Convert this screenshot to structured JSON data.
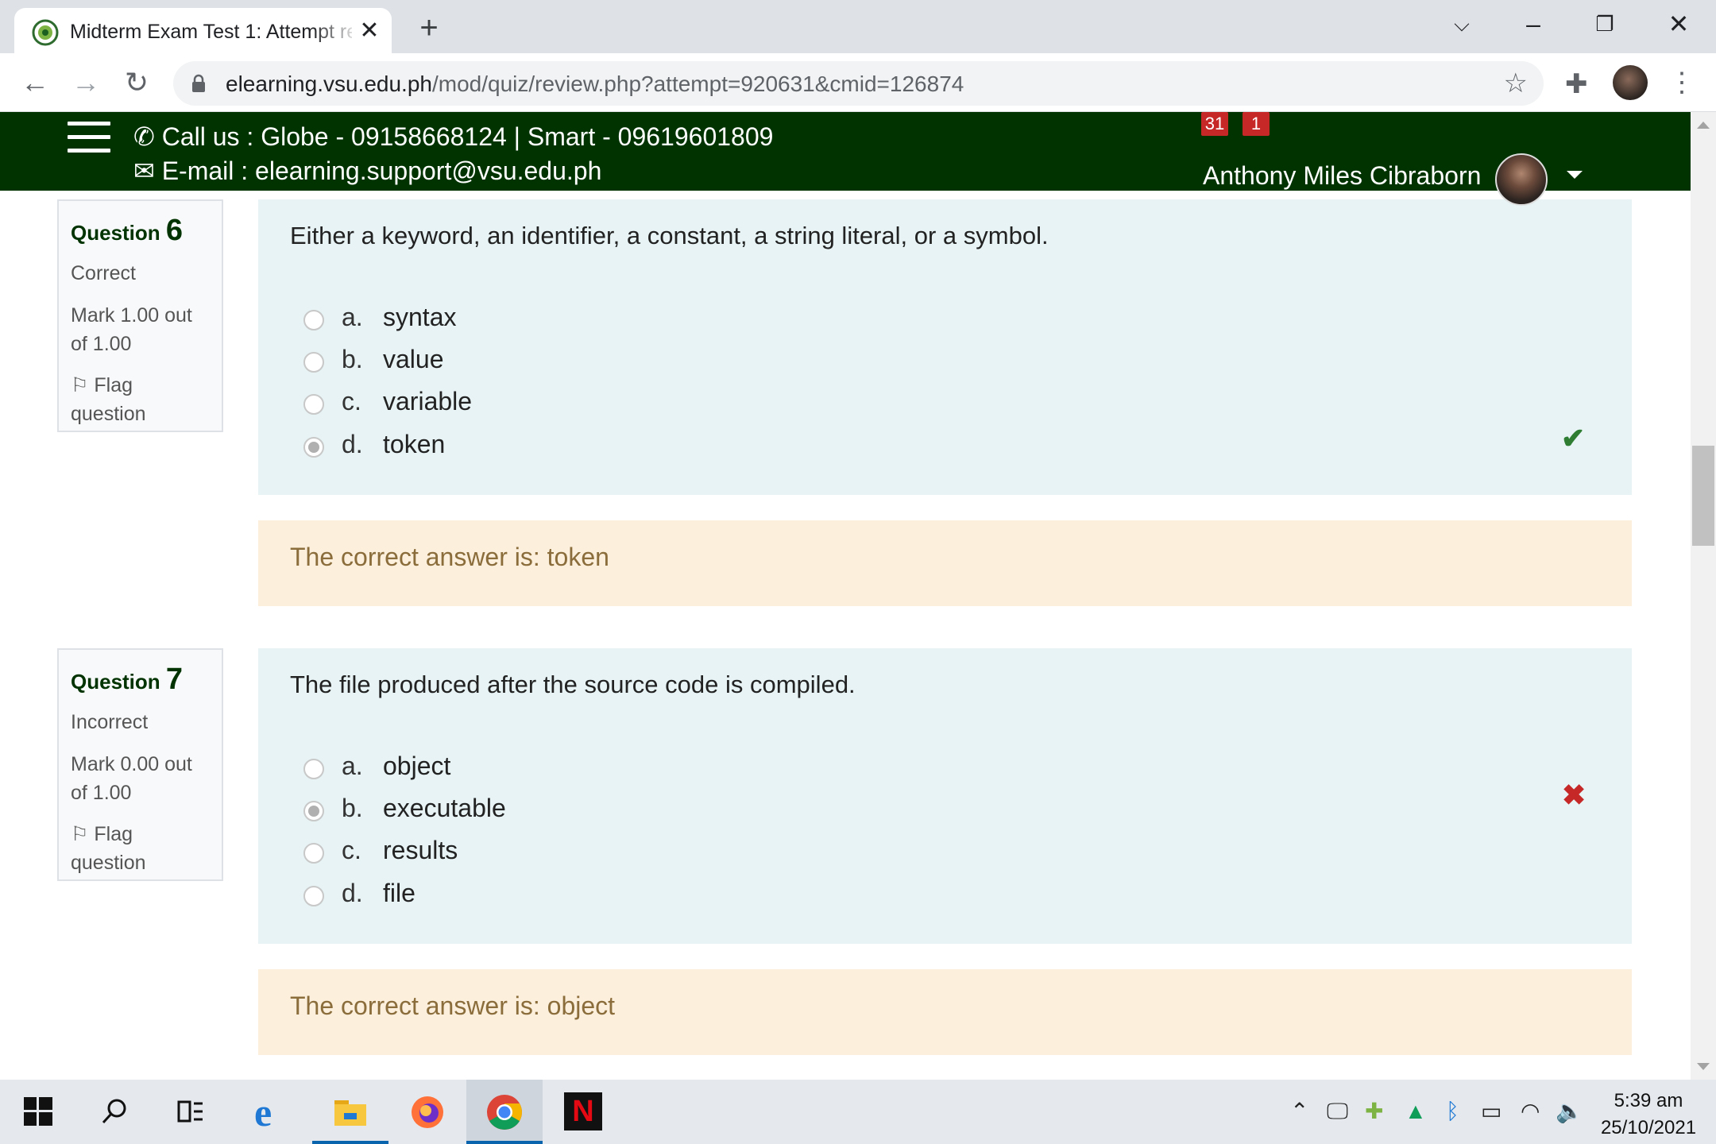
{
  "browser": {
    "tab_title": "Midterm Exam Test 1: Attempt re",
    "new_tab": "+",
    "url_host": "elearning.vsu.edu.ph",
    "url_path": "/mod/quiz/review.php?attempt=920631&cmid=126874"
  },
  "header": {
    "call_us": "Call us : Globe - 09158668124  |  Smart - 09619601809",
    "email": "E-mail : elearning.support@vsu.edu.ph",
    "notification_count": "31",
    "message_count": "1",
    "user_name": "Anthony Miles Cibraborn"
  },
  "questions": [
    {
      "label": "Question",
      "number": "6",
      "state": "Correct",
      "grade": "Mark 1.00 out of 1.00",
      "flag": "Flag question",
      "text": "Either a keyword, an identifier, a constant, a string literal, or a symbol.",
      "options": [
        {
          "letter": "a.",
          "text": "syntax",
          "selected": false
        },
        {
          "letter": "b.",
          "text": "value",
          "selected": false
        },
        {
          "letter": "c.",
          "text": "variable",
          "selected": false
        },
        {
          "letter": "d.",
          "text": "token",
          "selected": true
        }
      ],
      "result_icon": "check-icon",
      "feedback": "The correct answer is: token"
    },
    {
      "label": "Question",
      "number": "7",
      "state": "Incorrect",
      "grade": "Mark 0.00 out of 1.00",
      "flag": "Flag question",
      "text": "The file produced after the source code is compiled.",
      "options": [
        {
          "letter": "a.",
          "text": "object",
          "selected": false
        },
        {
          "letter": "b.",
          "text": "executable",
          "selected": true
        },
        {
          "letter": "c.",
          "text": "results",
          "selected": false
        },
        {
          "letter": "d.",
          "text": "file",
          "selected": false
        }
      ],
      "result_icon": "cross-icon",
      "feedback": "The correct answer is: object"
    }
  ],
  "taskbar": {
    "clock_time": "5:39 am",
    "clock_date": "25/10/2021"
  },
  "colors": {
    "header_bg": "#003300",
    "question_bg": "#e7f3f5",
    "feedback_bg": "#fcefdc",
    "correct": "#2e7d32",
    "incorrect": "#c62828"
  }
}
